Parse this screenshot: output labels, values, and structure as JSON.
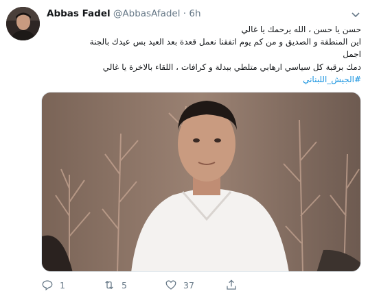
{
  "tweet": {
    "author_name": "Abbas Fadel",
    "handle": "@AbbasAfadel",
    "separator": "·",
    "time": "6h",
    "lines": [
      "حسن يا حسن ، الله يرحمك يا غالي",
      "اين المنطقة و الصديق و من كم يوم اتفقنا نعمل قعدة بعد العيد بس عيدك بالجنة",
      "اجمل",
      "دمك برقبة كل سياسي ارهابي متلطي ببدلة و كرافات ، اللقاء بالاخرة يا غالي"
    ],
    "hashtag": "#الجيش_اللبناني",
    "actions": {
      "reply_count": "1",
      "retweet_count": "5",
      "like_count": "37"
    }
  },
  "colors": {
    "accent": "#1b95e0",
    "secondary_text": "#657786",
    "primary_text": "#14171a"
  },
  "icons": [
    "avatar-photo",
    "chevron-down-icon",
    "reply-icon",
    "retweet-icon",
    "like-icon",
    "share-icon"
  ]
}
